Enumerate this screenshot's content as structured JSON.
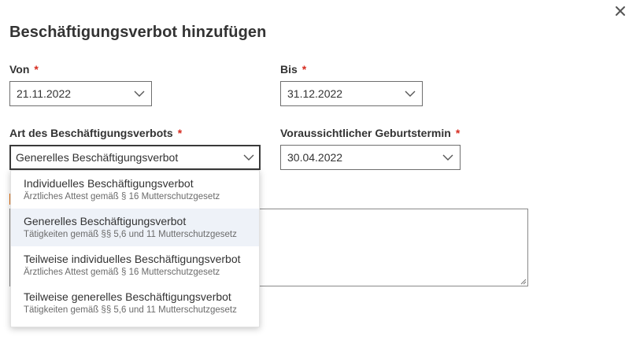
{
  "dialog": {
    "title": "Beschäftigungsverbot hinzufügen",
    "close_icon": "close-icon"
  },
  "form": {
    "required_marker": "*",
    "von": {
      "label": "Von",
      "value": "21.11.2022"
    },
    "bis": {
      "label": "Bis",
      "value": "31.12.2022"
    },
    "art": {
      "label": "Art des Beschäftigungsverbots",
      "value": "Generelles Beschäftigungsverbot"
    },
    "geburtstermin": {
      "label": "Voraussichtlicher Geburtstermin",
      "value": "30.04.2022"
    }
  },
  "dropdown": {
    "selected_index": 1,
    "options": [
      {
        "label": "Individuelles Beschäftigungsverbot",
        "description": "Ärztliches Attest gemäß § 16 Mutterschutzgesetz"
      },
      {
        "label": "Generelles Beschäftigungsverbot",
        "description": "Tätigkeiten gemäß §§ 5,6 und 11 Mutterschutzgesetz"
      },
      {
        "label": "Teilweise individuelles Beschäftigungsverbot",
        "description": "Ärztliches Attest gemäß § 16 Mutterschutzgesetz"
      },
      {
        "label": "Teilweise generelles Beschäftigungsverbot",
        "description": "Tätigkeiten gemäß §§ 5,6 und 11 Mutterschutzgesetz"
      }
    ]
  },
  "colors": {
    "required": "#d62b1f",
    "selected_option_bg": "#eef2f8",
    "accent": "#e36c0a"
  }
}
